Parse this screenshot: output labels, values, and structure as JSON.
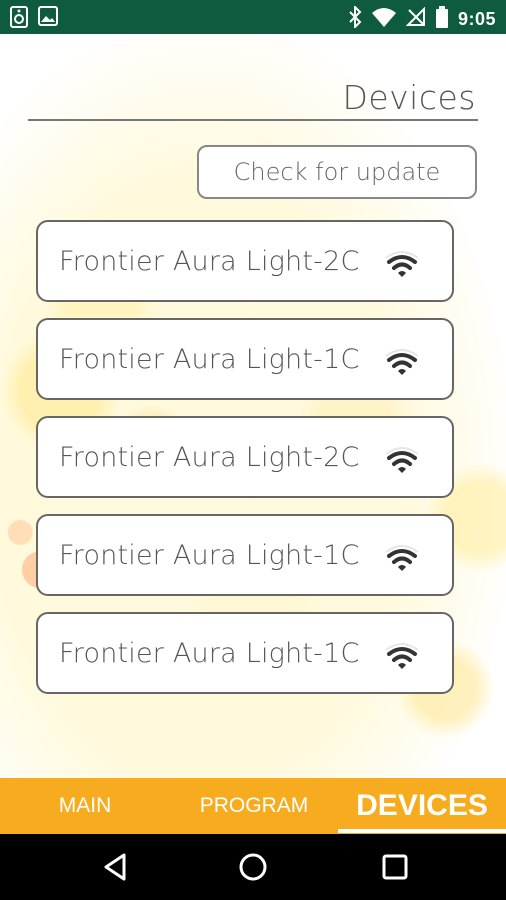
{
  "status_bar": {
    "time": "9:05",
    "left_icons": [
      "speaker-icon",
      "image-icon"
    ],
    "right_icons": [
      "bluetooth-icon",
      "wifi-icon",
      "no-sim-icon",
      "battery-icon"
    ]
  },
  "header": {
    "title": "Devices",
    "update_button": "Check for update"
  },
  "devices": [
    {
      "name": "Frontier Aura Light-2C",
      "icon": "wifi-icon"
    },
    {
      "name": "Frontier Aura Light-1C",
      "icon": "wifi-icon"
    },
    {
      "name": "Frontier Aura Light-2C",
      "icon": "wifi-icon"
    },
    {
      "name": "Frontier Aura Light-1C",
      "icon": "wifi-icon"
    },
    {
      "name": "Frontier Aura Light-1C",
      "icon": "wifi-icon"
    }
  ],
  "tabs": [
    {
      "label": "MAIN",
      "active": false
    },
    {
      "label": "PROGRAM",
      "active": false
    },
    {
      "label": "DEVICES",
      "active": true
    }
  ],
  "nav_bar": [
    "back-icon",
    "home-icon",
    "recents-icon"
  ],
  "colors": {
    "status_bar": "#0f5b3f",
    "tab_bar": "#f7ac20",
    "nav_bar": "#000000"
  }
}
